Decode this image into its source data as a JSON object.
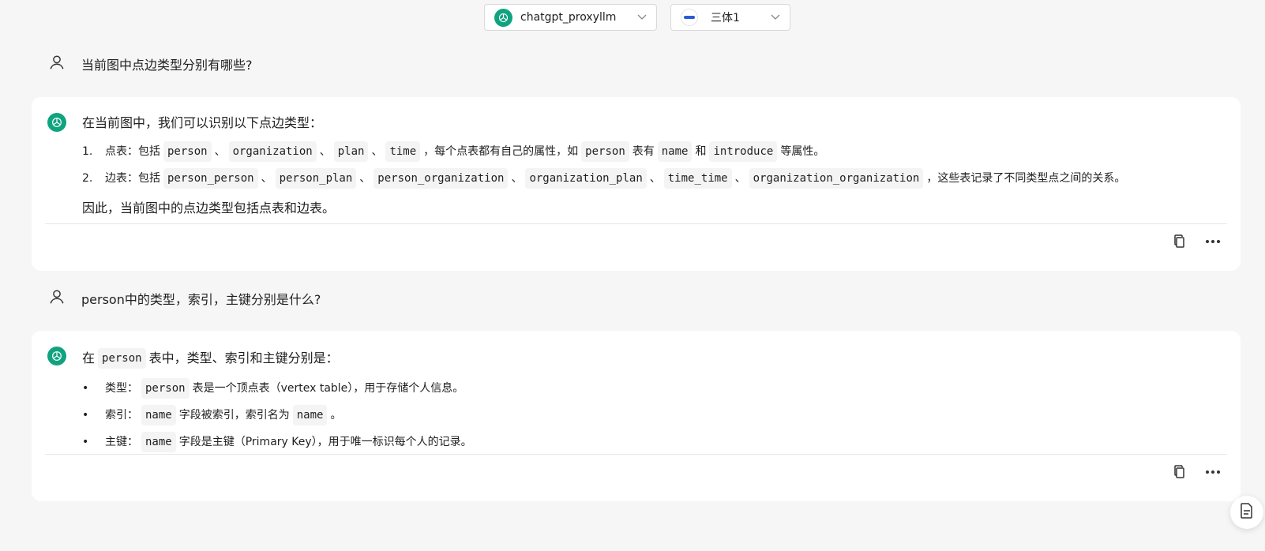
{
  "header": {
    "model_select": {
      "value": "chatgpt_proxyllm",
      "icon": "openai-logo-icon"
    },
    "graph_select": {
      "value": "三体1",
      "icon": "graph-db-logo-icon"
    }
  },
  "conversation": [
    {
      "role": "user",
      "text": "当前图中点边类型分别有哪些?"
    },
    {
      "role": "assistant",
      "lead": "在当前图中，我们可以识别以下点边类型：",
      "list": [
        {
          "marker": "1.",
          "segments": [
            {
              "t": "点表：包括"
            },
            {
              "c": "person"
            },
            {
              "t": "、"
            },
            {
              "c": "organization"
            },
            {
              "t": "、"
            },
            {
              "c": "plan"
            },
            {
              "t": "、"
            },
            {
              "c": "time"
            },
            {
              "t": "，每个点表都有自己的属性，如"
            },
            {
              "c": "person"
            },
            {
              "t": "表有"
            },
            {
              "c": "name"
            },
            {
              "t": "和"
            },
            {
              "c": "introduce"
            },
            {
              "t": "等属性。"
            }
          ]
        },
        {
          "marker": "2.",
          "segments": [
            {
              "t": "边表：包括"
            },
            {
              "c": "person_person"
            },
            {
              "t": "、"
            },
            {
              "c": "person_plan"
            },
            {
              "t": "、"
            },
            {
              "c": "person_organization"
            },
            {
              "t": "、"
            },
            {
              "c": "organization_plan"
            },
            {
              "t": "、"
            },
            {
              "c": "time_time"
            },
            {
              "t": "、"
            },
            {
              "c": "organization_organization"
            },
            {
              "t": "，这些表记录了不同类型点之间的关系。"
            }
          ]
        }
      ],
      "conclusion": "因此，当前图中的点边类型包括点表和边表。"
    },
    {
      "role": "user",
      "text": "person中的类型，索引，主键分别是什么?"
    },
    {
      "role": "assistant",
      "lead_segments": [
        {
          "t": "在"
        },
        {
          "c": "person"
        },
        {
          "t": "表中，类型、索引和主键分别是："
        }
      ],
      "list": [
        {
          "marker": "•",
          "segments": [
            {
              "t": "类型："
            },
            {
              "c": "person"
            },
            {
              "t": "表是一个顶点表（vertex table），用于存储个人信息。"
            }
          ]
        },
        {
          "marker": "•",
          "segments": [
            {
              "t": "索引："
            },
            {
              "c": "name"
            },
            {
              "t": "字段被索引，索引名为"
            },
            {
              "c": "name"
            },
            {
              "t": "。"
            }
          ]
        },
        {
          "marker": "•",
          "segments": [
            {
              "t": "主键："
            },
            {
              "c": "name"
            },
            {
              "t": "字段是主键（Primary Key），用于唯一标识每个人的记录。"
            }
          ]
        }
      ]
    }
  ],
  "actions": {
    "copy_icon": "copy-icon",
    "more_icon": "more-horizontal-icon"
  },
  "fab_icon": "document-icon",
  "colors": {
    "accent": "#10a37f",
    "background": "#f6f6f7",
    "card": "#ffffff"
  }
}
